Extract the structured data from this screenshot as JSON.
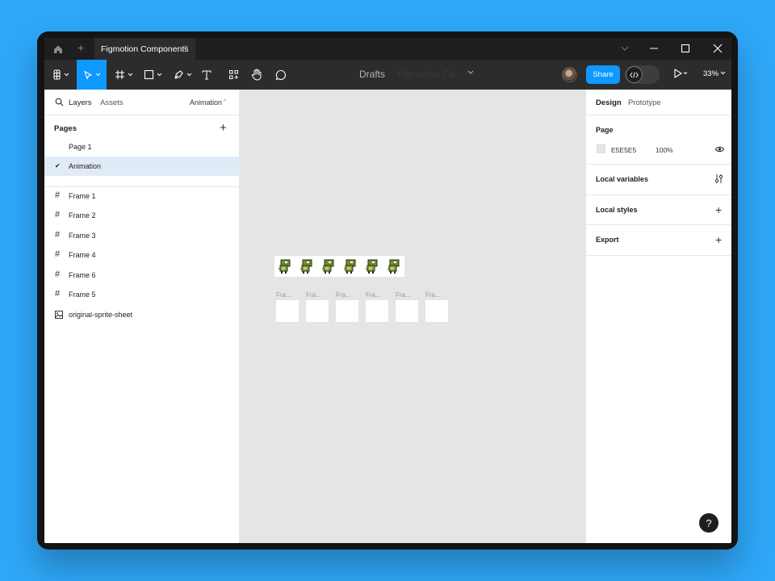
{
  "window": {
    "tab_title": "Figmotion Components",
    "tab_close": "×",
    "new_tab": "+"
  },
  "toolbar": {
    "location": "Drafts",
    "file_name": "Figmotion Co...",
    "share_label": "Share",
    "zoom": "33%"
  },
  "left_panel": {
    "tabs": [
      "Layers",
      "Assets"
    ],
    "current_page": "Animation",
    "pages_title": "Pages",
    "pages": [
      {
        "label": "Page 1",
        "selected": false
      },
      {
        "label": "Animation",
        "selected": true
      }
    ],
    "layers": [
      "Frame 1",
      "Frame 2",
      "Frame 3",
      "Frame 4",
      "Frame 6",
      "Frame 5"
    ],
    "image_layer": "original-sprite-sheet"
  },
  "right_panel": {
    "tabs": [
      "Design",
      "Prototype"
    ],
    "page_section": "Page",
    "background_hex": "E5E5E5",
    "background_opacity": "100%",
    "sections": [
      "Local variables",
      "Local styles",
      "Export"
    ]
  },
  "canvas": {
    "frame_labels": [
      "Fra...",
      "Fra...",
      "Fra...",
      "Fra...",
      "Fra...",
      "Fra..."
    ],
    "sprite_count": 6
  },
  "help_label": "?",
  "colors": {
    "background": "#2ea7f7",
    "accent": "#0d99ff",
    "canvas": "#e5e5e5"
  },
  "icons": [
    "home-icon",
    "move-tool-icon",
    "frame-tool-icon",
    "rectangle-tool-icon",
    "pen-tool-icon",
    "text-tool-icon",
    "resources-icon",
    "hand-tool-icon",
    "comment-icon",
    "dev-mode-icon",
    "play-icon",
    "search-icon",
    "eye-icon",
    "variables-icon"
  ]
}
